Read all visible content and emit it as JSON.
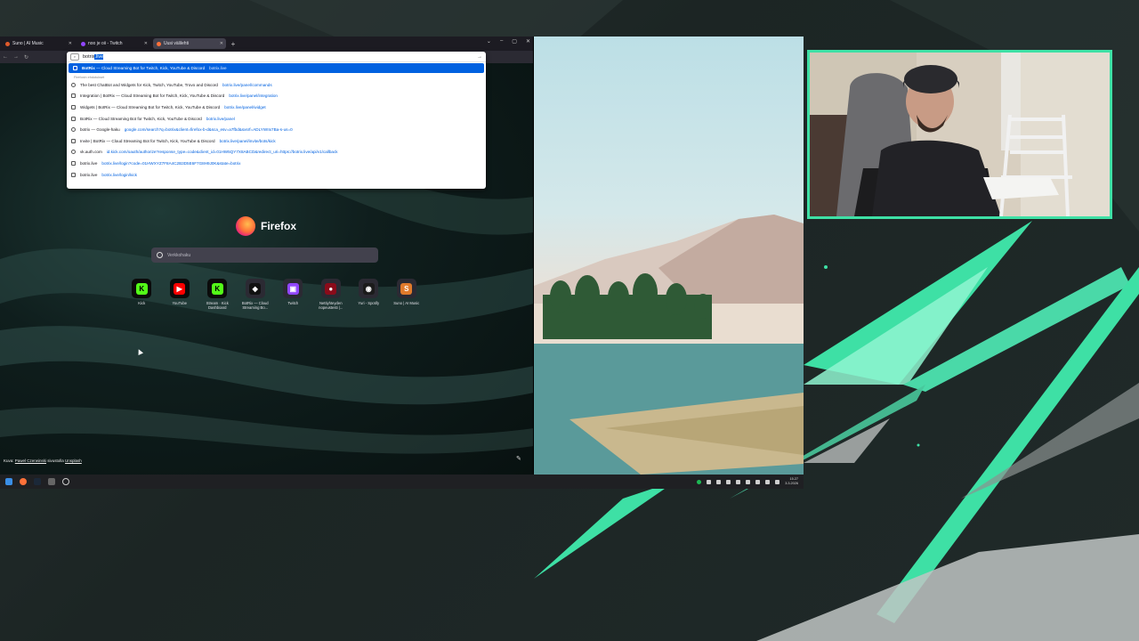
{
  "browser": {
    "tabs": [
      {
        "title": "Suno | AI Music",
        "color": "#e05a2b",
        "active": false
      },
      {
        "title": "noo je oii - Twitch",
        "color": "#9146ff",
        "active": false
      },
      {
        "title": "Uusi välilehti",
        "color": "#ff7139",
        "active": true
      }
    ],
    "new_tab_label": "+",
    "url_typed": "botrix",
    "url_selected": ".live",
    "url_go": "→"
  },
  "suggestions": {
    "top": {
      "title": "BotRix",
      "desc": " — Cloud Streaming Bot for Twitch, Kick, YouTube & Discord",
      "url": "botrix.live"
    },
    "header": "Firefoxin ehdotukset",
    "items": [
      {
        "title": "The best ChatBot and Widgets for Kick, Twitch, YouTube, Trovo and Discord",
        "url": "botrix.live/panel/commands"
      },
      {
        "title": "Integration | BotRix — Cloud Streaming Bot for Twitch, Kick, YouTube & Discord",
        "url": "botrix.live/panel/integration"
      },
      {
        "title": "Widgets | BotRix — Cloud Streaming Bot for Twitch, Kick, YouTube & Discord",
        "url": "botrix.live/panel/widget"
      },
      {
        "title": "BotRix — Cloud Streaming Bot for Twitch, Kick, YouTube & Discord",
        "url": "botrix.live/panel"
      },
      {
        "title": "botrix — Google-haku",
        "url": "google.com/search?q=botrix&client=firefox-b-d&sca_esv=a7fbd&sxsrf=ADLYWIIx7Ba-s-us=0"
      },
      {
        "title": "Invite | BotRix — Cloud Streaming Bot for Twitch, Kick, YouTube & Discord",
        "url": "botrix.live/panel/invite/bots/kick"
      },
      {
        "title": "vk.auth.com",
        "url": "id.kick.com/oauth/authorize?response_type=code&client_id=01HW5QY7X8ABCD&redirect_uri=https://botrix.live/api/v1/callback"
      },
      {
        "title": "botrix.live",
        "url": "botrix.live/login?code=01HWXYZ7F8A4C2B3D5E6F7G8H9J0K&state=botrix"
      },
      {
        "title": "botrix.live",
        "url": "botrix.live/login/kick"
      }
    ]
  },
  "home": {
    "brand": "Firefox",
    "search_placeholder": "Verkkohaku",
    "top_sites": [
      {
        "label": "Kick",
        "bg": "#0b0b0b",
        "icon_bg": "#53fc18",
        "glyph": "K"
      },
      {
        "label": "YouTube",
        "bg": "#0b0b0b",
        "icon_bg": "#ff0000",
        "glyph": "▶"
      },
      {
        "label": "Stream · Kick Dashboard",
        "bg": "#0b0b0b",
        "icon_bg": "#53fc18",
        "glyph": "K"
      },
      {
        "label": "BotRix — Cloud Streaming Bo...",
        "bg": "#2b2a33",
        "icon_bg": "#111111",
        "glyph": "◆"
      },
      {
        "label": "Twitch",
        "bg": "#2b2a33",
        "icon_bg": "#9146ff",
        "glyph": "▣"
      },
      {
        "label": "Nettiyhteyden nopeustesti |...",
        "bg": "#2b2a33",
        "icon_bg": "#8b0b1a",
        "glyph": "●"
      },
      {
        "label": "Yuri - Spotify",
        "bg": "#2b2a33",
        "icon_bg": "#1b1b1b",
        "glyph": "◉"
      },
      {
        "label": "Suno | AI Music",
        "bg": "#2b2a33",
        "icon_bg": "#e07a2b",
        "glyph": "S"
      }
    ],
    "photo_credit_prefix": "Kuva: ",
    "photo_credit_author": "Pawel Czerwinski",
    "photo_credit_mid": " sivustolla ",
    "photo_credit_site": "Unsplash"
  },
  "taskbar": {
    "time": "15.27",
    "date": "3.3.2026"
  },
  "colors": {
    "overlay_accent": "#3ee0a5",
    "link_blue": "#0061e0"
  },
  "icons": [
    "windows-start-icon",
    "firefox-icon",
    "steam-icon",
    "app-icon",
    "settings-icon",
    "search-icon",
    "pencil-icon"
  ]
}
